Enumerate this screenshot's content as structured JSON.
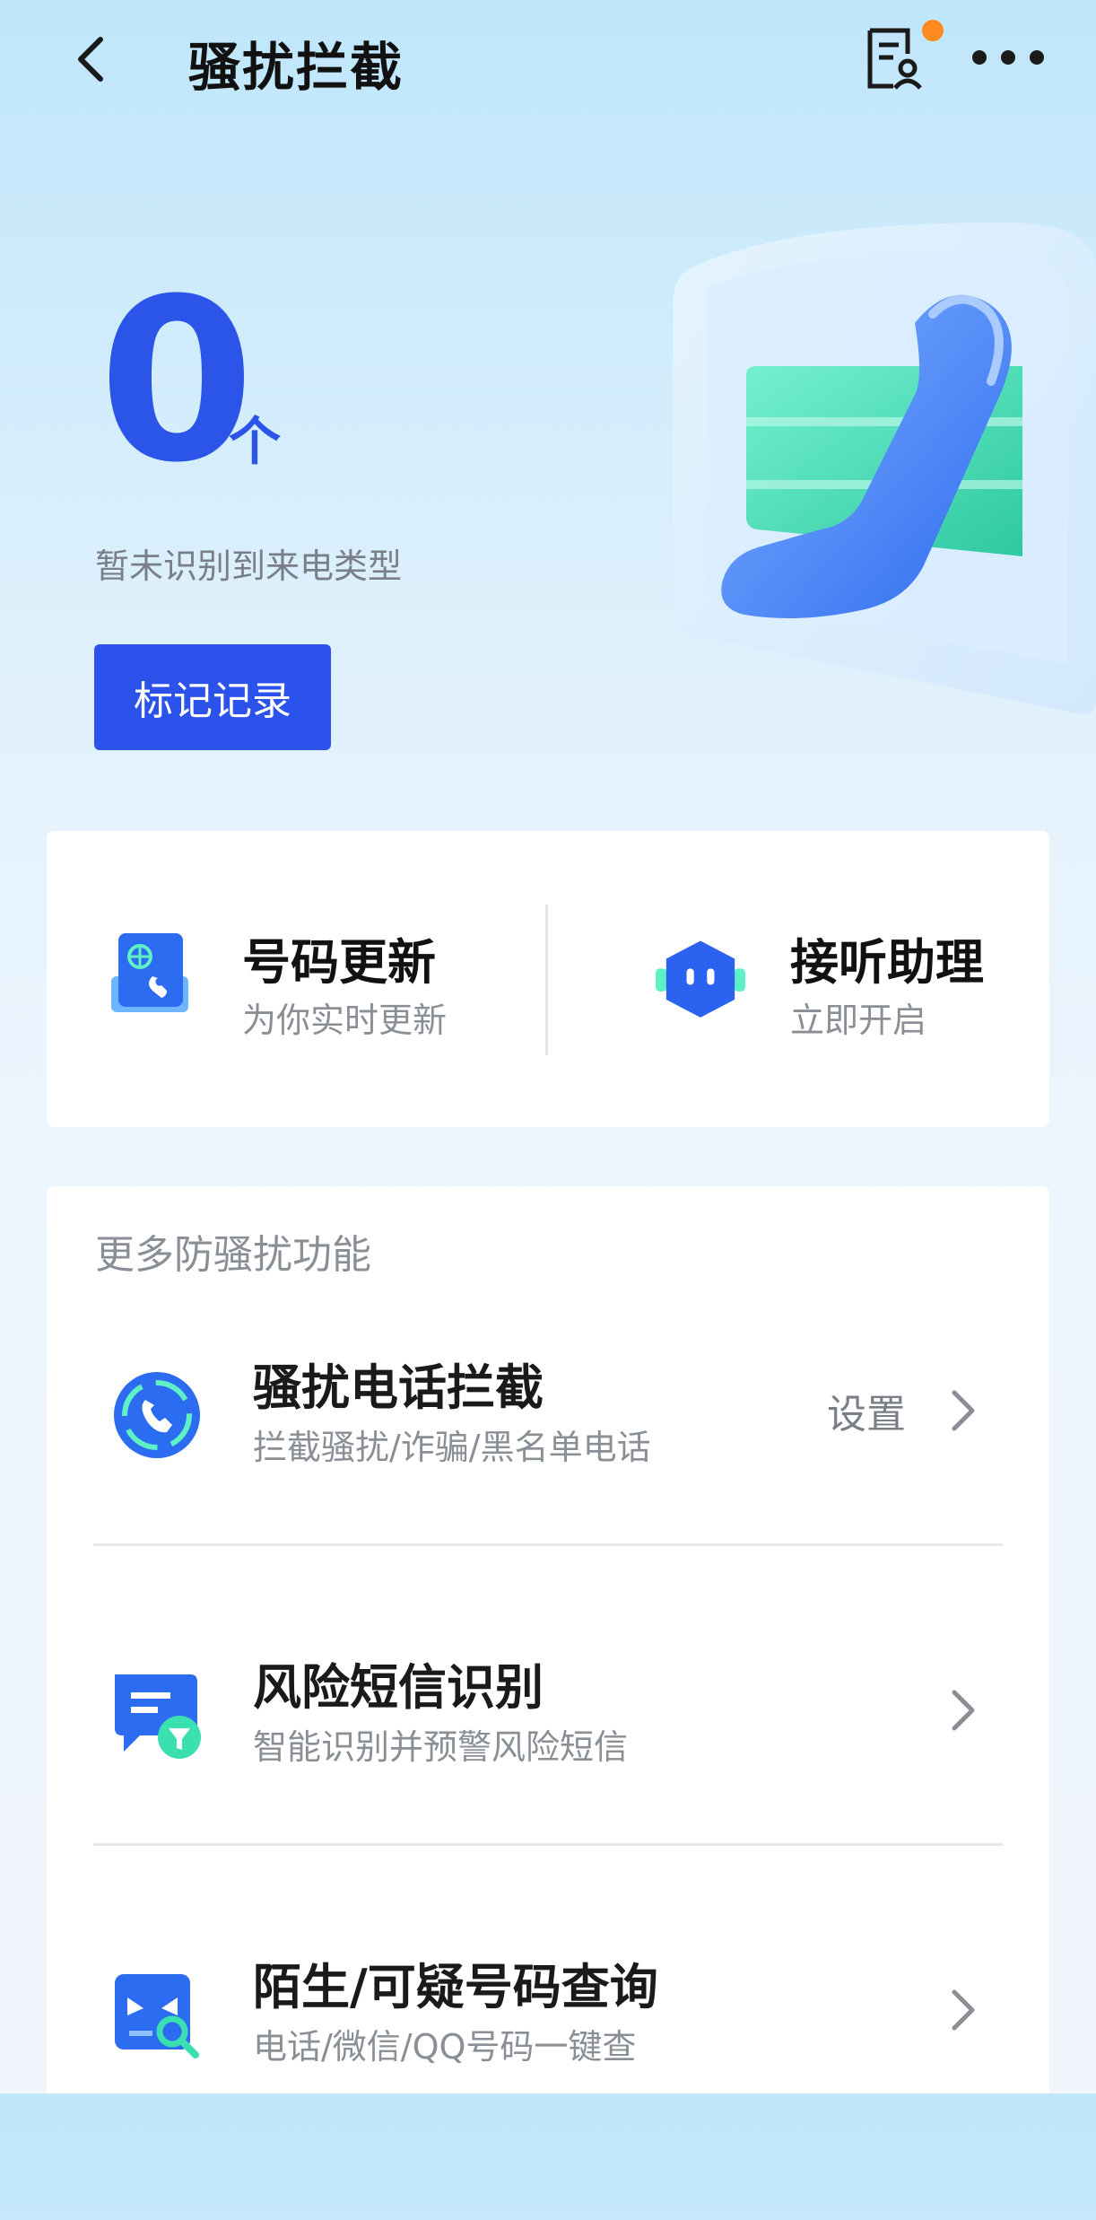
{
  "header": {
    "title": "骚扰拦截"
  },
  "hero": {
    "count": "0",
    "unit": "个",
    "subtitle": "暂未识别到来电类型",
    "mark_button": "标记记录"
  },
  "quick_actions": [
    {
      "title": "号码更新",
      "subtitle": "为你实时更新",
      "icon": "number-update-icon"
    },
    {
      "title": "接听助理",
      "subtitle": "立即开启",
      "icon": "assistant-robot-icon"
    }
  ],
  "more_section": {
    "heading": "更多防骚扰功能",
    "items": [
      {
        "title": "骚扰电话拦截",
        "subtitle": "拦截骚扰/诈骗/黑名单电话",
        "action": "设置",
        "icon": "phone-block-icon"
      },
      {
        "title": "风险短信识别",
        "subtitle": "智能识别并预警风险短信",
        "action": "",
        "icon": "sms-filter-icon"
      },
      {
        "title": "陌生/可疑号码查询",
        "subtitle": "电话/微信/QQ号码一键查",
        "action": "",
        "icon": "number-search-icon"
      }
    ]
  },
  "colors": {
    "accent": "#2b52ea",
    "badge": "#ff8a1f",
    "teal": "#2fe0b0"
  }
}
